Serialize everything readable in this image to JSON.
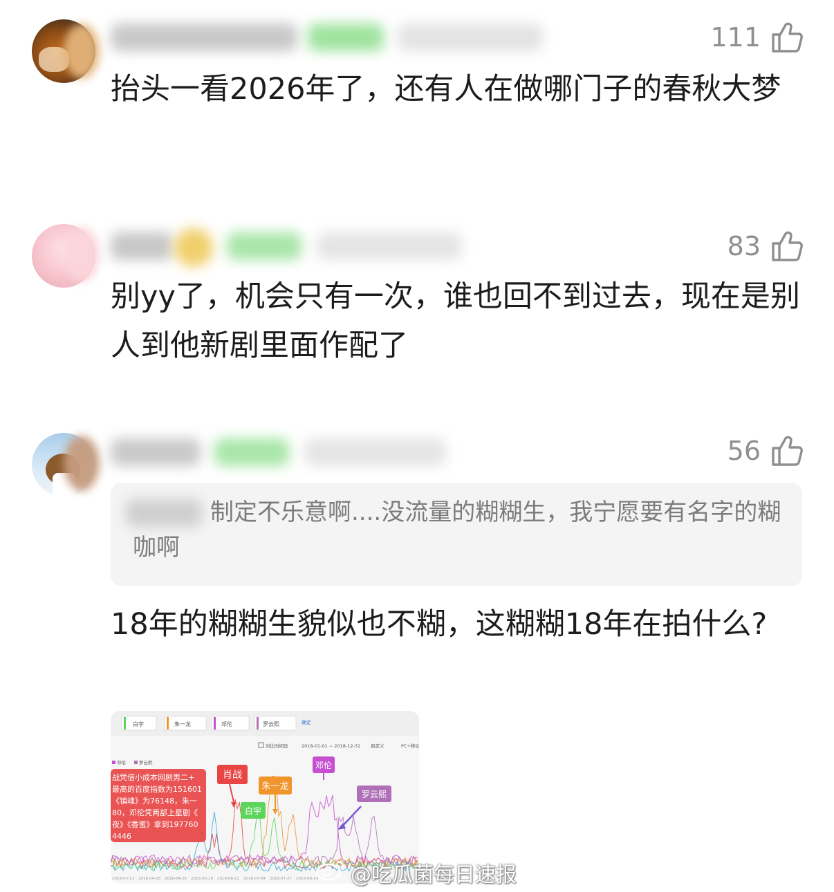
{
  "comments": [
    {
      "likes": "111",
      "text": "抬头一看2026年了，还有人在做哪门子的春秋大梦"
    },
    {
      "likes": "83",
      "text": "别yy了，机会只有一次，谁也回不到过去，现在是别人到他新剧里面作配了"
    },
    {
      "likes": "56",
      "quote": "制定不乐意啊....没流量的糊糊生，我宁愿要有名字的糊咖啊",
      "text": "18年的糊糊生貌似也不糊，这糊糊18年在拍什么?"
    }
  ],
  "image": {
    "legend_tabs": [
      "白宇",
      "朱一龙",
      "邓伦",
      "罗云熙"
    ],
    "confirm_label": "确定",
    "compare_label": "对比时间段",
    "date_range": "2018-01-01 ~ 2018-12-31",
    "custom_label": "自定义",
    "device_label": "PC+移动",
    "mini_legend": [
      "邓伦",
      "罗云熙"
    ],
    "annotation_lines": [
      "战凭借小成本网剧男二+",
      "最高的百度指数为151601",
      "《镇魂》为76148，朱一",
      "80，邓伦凭两部上星剧《",
      "夜》《香蜜》拿到197760",
      "4446"
    ],
    "callouts": [
      "肖战",
      "朱一龙",
      "白宇",
      "邓伦",
      "罗云熙"
    ],
    "x_ticks": [
      "2018-03-11",
      "2018-04-03",
      "2018-04-26",
      "2018-05-19",
      "2018-06-11",
      "2018-07-04",
      "2018-07-27",
      "2018-08-19"
    ]
  },
  "watermark": "@吃瓜菌每日速报",
  "colors": {
    "like": "#8f8f8f",
    "quote_bg": "#f4f4f4",
    "xiaozhan": "#e84545",
    "zhuyilong": "#f0952b",
    "baiyu": "#5bd65b",
    "denglun": "#c54fd0",
    "luoyunxi": "#b070b8"
  }
}
